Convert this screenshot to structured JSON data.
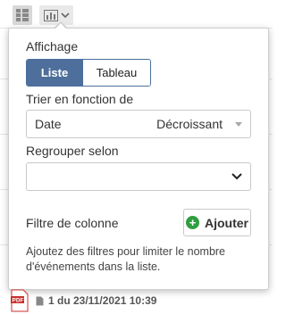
{
  "popover": {
    "display_label": "Affichage",
    "view_options": [
      "Liste",
      "Tableau"
    ],
    "sort_label": "Trier en fonction de",
    "sort_field": "Date",
    "sort_order": "Décroissant",
    "group_label": "Regrouper selon",
    "group_value": "",
    "column_filter_label": "Filtre de colonne",
    "add_button_label": "Ajouter",
    "help_text": "Ajoutez des filtres pour limiter le nombre d'événements dans la liste."
  },
  "background_item": {
    "text": "1 du 23/11/2021 10:39"
  },
  "icons": {
    "grid": "grid-view-icon",
    "chart": "chart-icon",
    "plus": "plus-circle-icon",
    "pdf": "pdf-icon",
    "doc": "document-icon"
  },
  "colors": {
    "accent": "#4e6f9b",
    "add_green": "#2e9e3f",
    "pdf_red": "#c9302c"
  }
}
